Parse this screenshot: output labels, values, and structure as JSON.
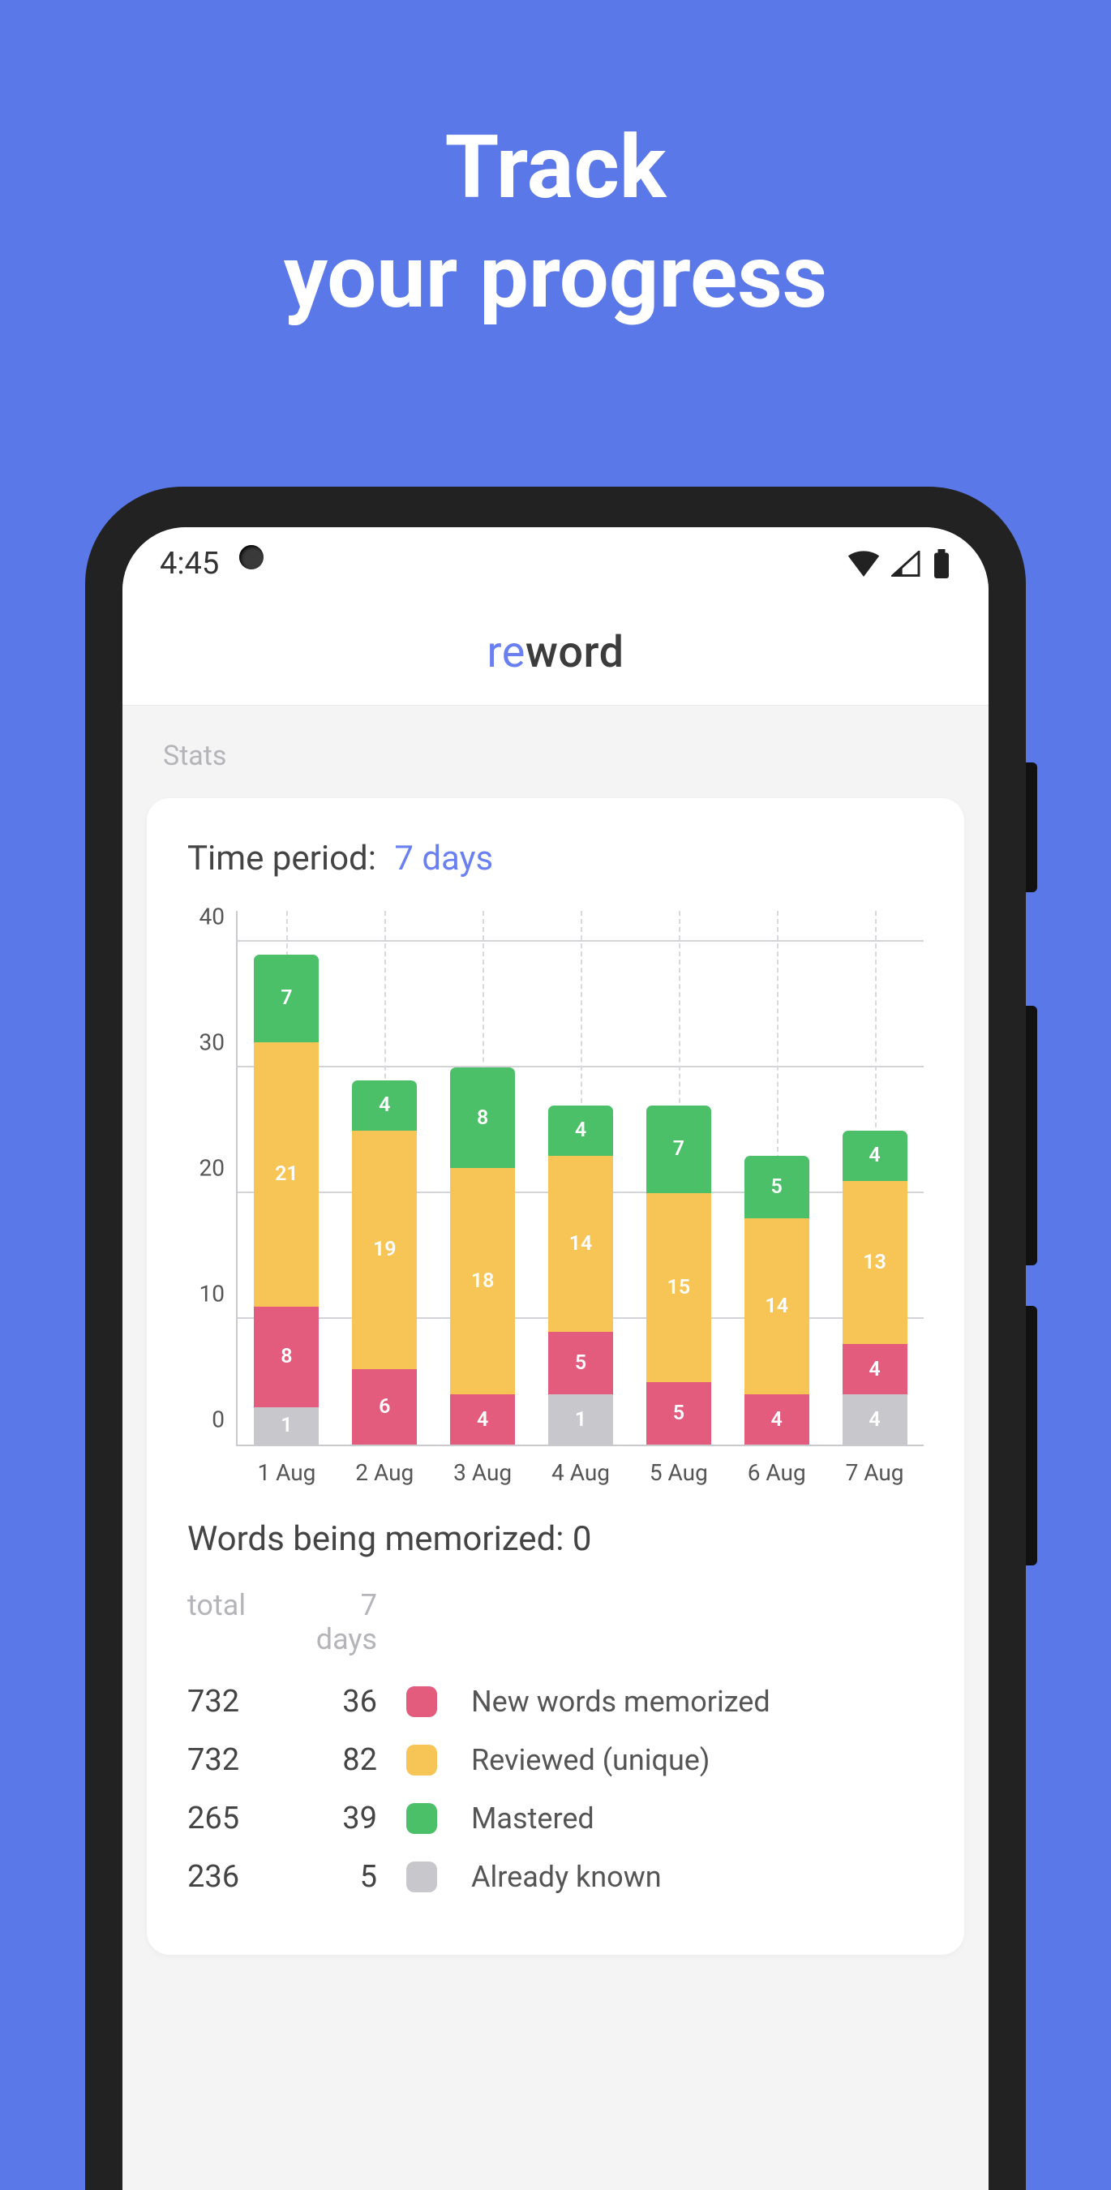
{
  "headline": {
    "line1": "Track",
    "line2": "your progress"
  },
  "status": {
    "time": "4:45"
  },
  "app": {
    "logo_re": "re",
    "logo_word": "word"
  },
  "section_label": "Stats",
  "card": {
    "time_period_label": "Time period:",
    "time_period_value": "7 days",
    "memorized_label": "Words being memorized: 0",
    "table_header_total": "total",
    "table_header_period": "7 days",
    "rows": [
      {
        "total": "732",
        "period": "36",
        "label": "New words memorized",
        "swatch": "sw-new"
      },
      {
        "total": "732",
        "period": "82",
        "label": "Reviewed (unique)",
        "swatch": "sw-rev"
      },
      {
        "total": "265",
        "period": "39",
        "label": "Mastered",
        "swatch": "sw-mas"
      },
      {
        "total": "236",
        "period": "5",
        "label": "Already known",
        "swatch": "sw-kno"
      }
    ]
  },
  "chart_data": {
    "type": "bar",
    "stacked": true,
    "title": "",
    "xlabel": "",
    "ylabel": "",
    "ylim": [
      0,
      40
    ],
    "y_ticks": [
      0,
      10,
      20,
      30,
      40
    ],
    "categories": [
      "1 Aug",
      "2 Aug",
      "3 Aug",
      "4 Aug",
      "5 Aug",
      "6 Aug",
      "7 Aug"
    ],
    "series": [
      {
        "name": "Already known",
        "color": "#c7c7cc",
        "values": [
          3,
          0,
          0,
          4,
          0,
          0,
          4
        ],
        "labels": [
          "1",
          "",
          "",
          "1",
          "",
          "",
          "4"
        ]
      },
      {
        "name": "New words memorized",
        "color": "#e35b7d",
        "values": [
          8,
          6,
          4,
          5,
          5,
          4,
          4
        ],
        "labels": [
          "8",
          "6",
          "4",
          "5",
          "5",
          "4",
          "4"
        ]
      },
      {
        "name": "Reviewed (unique)",
        "color": "#f7c555",
        "values": [
          21,
          19,
          18,
          14,
          15,
          14,
          13
        ],
        "labels": [
          "21",
          "19",
          "18",
          "14",
          "15",
          "14",
          "13"
        ]
      },
      {
        "name": "Mastered",
        "color": "#4bc069",
        "values": [
          7,
          4,
          8,
          4,
          7,
          5,
          4
        ],
        "labels": [
          "7",
          "4",
          "8",
          "4",
          "7",
          "5",
          "4"
        ]
      }
    ]
  }
}
